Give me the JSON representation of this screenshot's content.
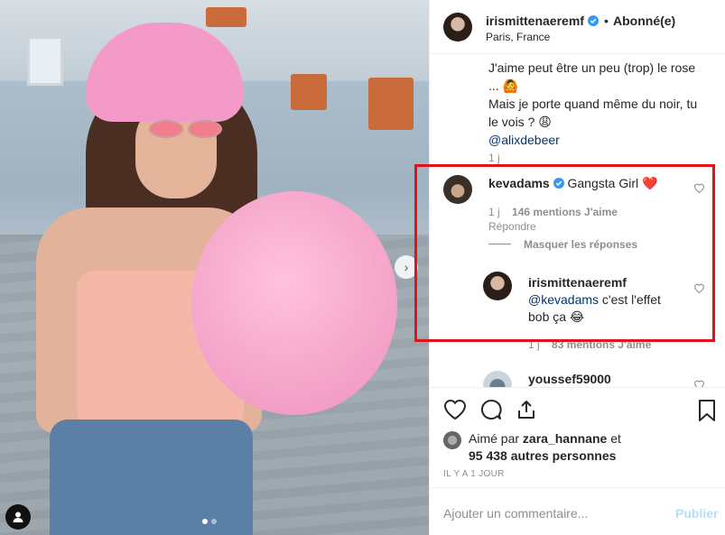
{
  "post": {
    "author": "irismittenaeremf",
    "follow_status": "Abonné(e)",
    "separator": "•",
    "location": "Paris, France"
  },
  "caption": {
    "lines": [
      "J'aime peut être un peu (trop) le rose",
      "... 🙆",
      "Mais je porte quand même du noir, tu",
      "le vois ? 😩"
    ],
    "mention": "@alixdebeer",
    "age": "1 j"
  },
  "comment_kevadams": {
    "username": "kevadams",
    "text": "Gangsta Girl",
    "emoji": "❤️",
    "age": "1 j",
    "likes": "146 mentions J'aime",
    "reply": "Répondre",
    "toggle_replies": "Masquer les réponses"
  },
  "reply_iris": {
    "username": "irismittenaeremf",
    "mention": "@kevadams",
    "text": "c'est l'effet",
    "text2": "bob ça 😂",
    "age": "1 j",
    "likes": "83 mentions J'aime"
  },
  "comment_youssef": {
    "username": "youssef59000"
  },
  "likes": {
    "prefix": "Aimé par",
    "user": "zara_hannane",
    "middle": "et",
    "count": "95 438 autres personnes"
  },
  "time": "IL Y A 1 JOUR",
  "composer": {
    "placeholder": "Ajouter un commentaire...",
    "publish": "Publier"
  },
  "colors": {
    "highlight_box": "#e0121a",
    "verified": "#3897f0",
    "link": "#00376b"
  }
}
